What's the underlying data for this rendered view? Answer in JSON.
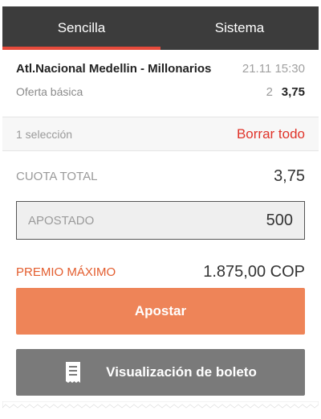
{
  "tabs": [
    {
      "label": "Sencilla",
      "active": true
    },
    {
      "label": "Sistema",
      "active": false
    }
  ],
  "bet": {
    "match": "Atl.Nacional Medellin - Millonarios",
    "date": "21.11 15:30",
    "market": "Oferta básica",
    "pick": "2",
    "odd": "3,75"
  },
  "summary": {
    "count": "1 selección",
    "clear_label": "Borrar todo"
  },
  "totals": {
    "odds_label": "CUOTA TOTAL",
    "odds_value": "3,75",
    "stake_label": "APOSTADO",
    "stake_value": "500",
    "prize_label": "PREMIO MÁXIMO",
    "prize_value": "1.875,00 COP"
  },
  "actions": {
    "place_label": "Apostar",
    "view_label": "Visualización de boleto"
  },
  "colors": {
    "accent_red": "#e64a3b",
    "place_button": "#ee8458",
    "view_button": "#7a7a7a",
    "tabbar": "#3c3c3c"
  },
  "icons": {
    "ticket": "receipt-icon"
  }
}
